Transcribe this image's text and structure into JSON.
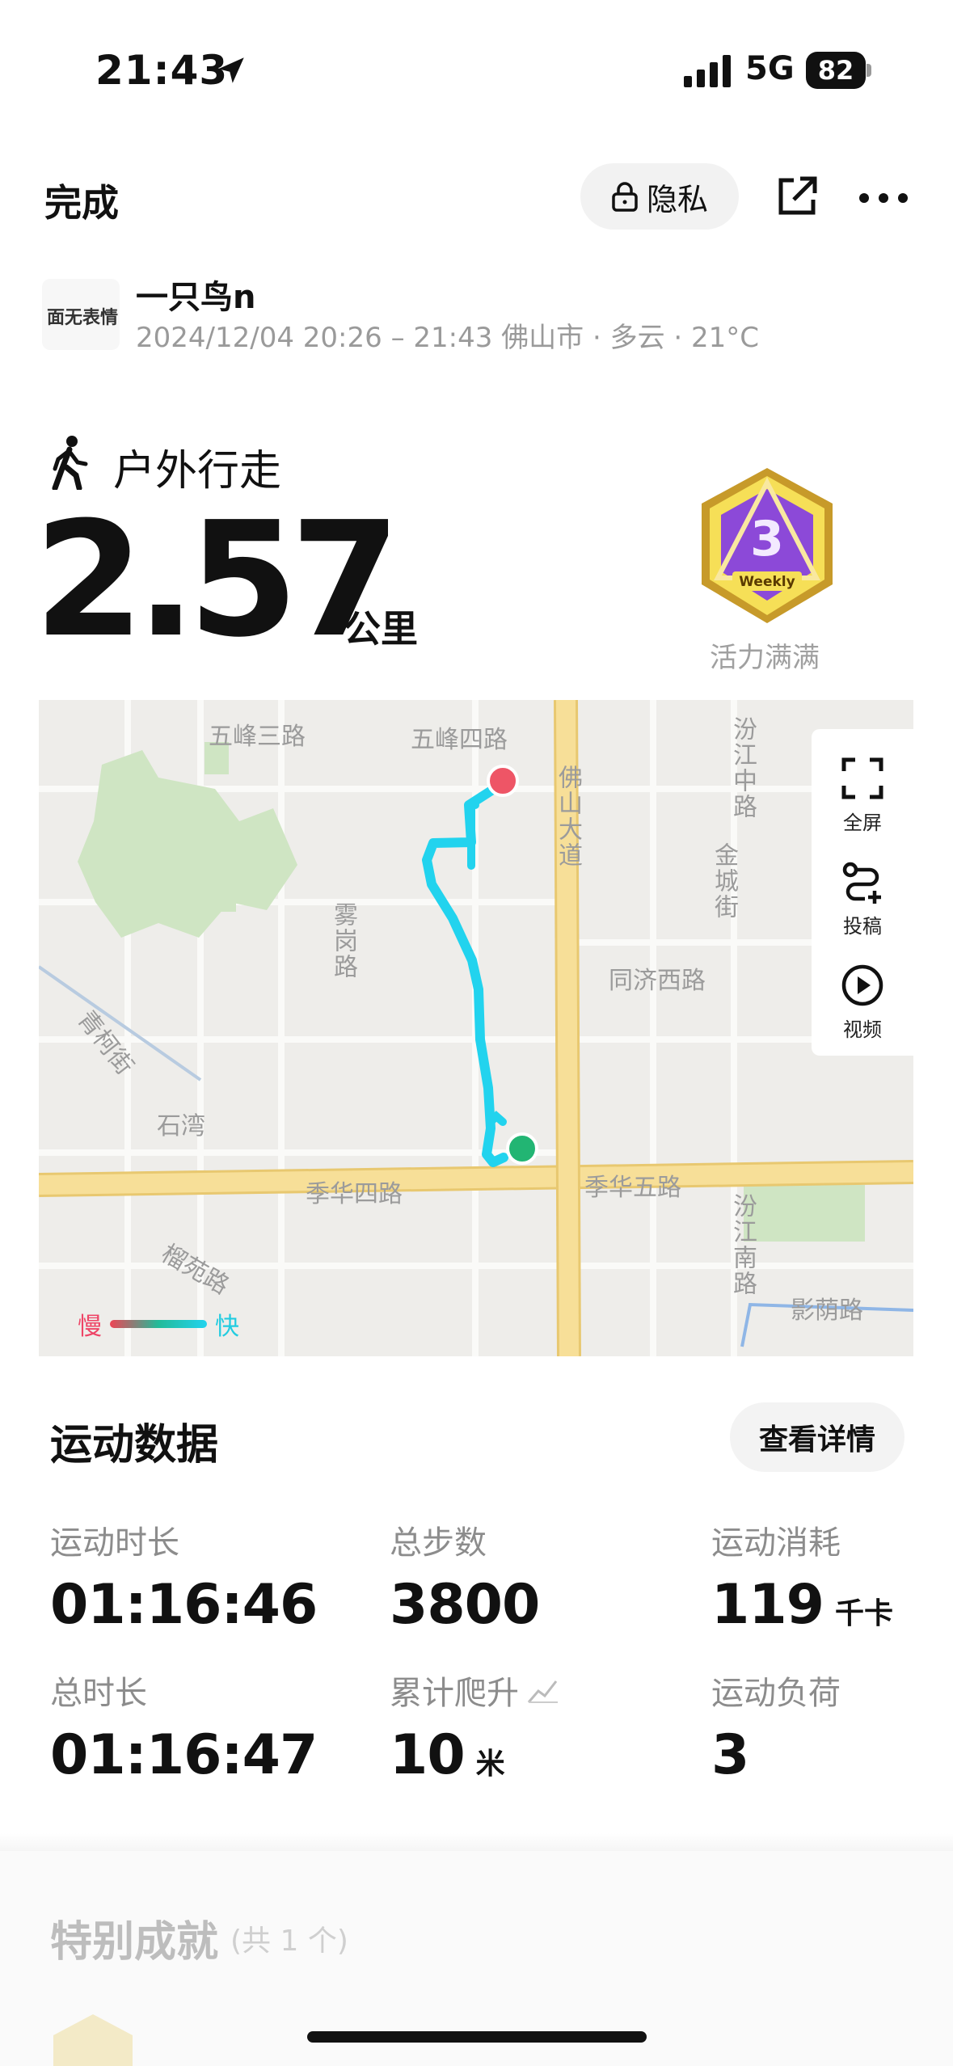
{
  "status_bar": {
    "time": "21:43",
    "network": "5G",
    "battery": "82"
  },
  "nav": {
    "done": "完成",
    "privacy": "隐私"
  },
  "user": {
    "avatar_text": "面无表情",
    "name": "一只鸟n",
    "meta": "2024/12/04 20:26 – 21:43 佛山市 · 多云 · 21°C"
  },
  "activity": {
    "type": "户外行走",
    "distance": "2.57",
    "distance_unit": "公里",
    "badge_text": "Weekly",
    "badge_label": "活力满满"
  },
  "map": {
    "labels": {
      "wufeng3": "五峰三路",
      "wufeng4": "五峰四路",
      "foshan_ave": "佛山大道",
      "fenjiang_mid": "汾江中路",
      "jincheng": "金城街",
      "wugang": "雾岗路",
      "tongji_w": "同济西路",
      "shiwan": "石湾",
      "jihua4": "季华四路",
      "jihua5": "季华五路",
      "fenjiang_s": "汾江南路",
      "liuyuan": "榴苑路",
      "yingyin": "影荫路",
      "diagonal": "青柯街"
    },
    "tools": {
      "fullscreen": "全屏",
      "post": "投稿",
      "video": "视频"
    },
    "legend": {
      "slow": "慢",
      "fast": "快"
    }
  },
  "stats": {
    "title": "运动数据",
    "detail_button": "查看详情",
    "items": [
      {
        "label": "运动时长",
        "value": "01:16:46",
        "unit": ""
      },
      {
        "label": "总步数",
        "value": "3800",
        "unit": ""
      },
      {
        "label": "运动消耗",
        "value": "119",
        "unit": "千卡"
      },
      {
        "label": "总时长",
        "value": "01:16:47",
        "unit": ""
      },
      {
        "label": "累计爬升",
        "value": "10",
        "unit": "米"
      },
      {
        "label": "运动负荷",
        "value": "3",
        "unit": ""
      }
    ]
  },
  "achievements": {
    "title": "特别成就",
    "count": "(共 1 个)"
  },
  "colors": {
    "route": "#22d3ee",
    "start": "#22b573",
    "end": "#ee5566",
    "road": "#f5dc97",
    "park": "#cfe5c3"
  }
}
